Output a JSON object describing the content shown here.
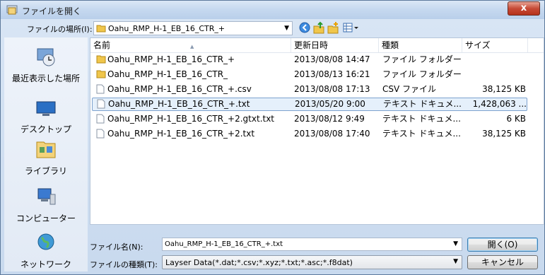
{
  "window": {
    "title": "ファイルを開く",
    "close_label": "x"
  },
  "lookin": {
    "label": "ファイルの場所(I):",
    "value": "Oahu_RMP_H-1_EB_16_CTR_+"
  },
  "toolbar": {
    "icons": [
      "back-icon",
      "up-folder-icon",
      "new-folder-icon",
      "view-menu-icon"
    ]
  },
  "sidebar": {
    "items": [
      {
        "label": "最近表示した場所",
        "icon": "recent-places-icon"
      },
      {
        "label": "デスクトップ",
        "icon": "desktop-icon"
      },
      {
        "label": "ライブラリ",
        "icon": "libraries-icon"
      },
      {
        "label": "コンピューター",
        "icon": "computer-icon"
      },
      {
        "label": "ネットワーク",
        "icon": "network-icon"
      }
    ]
  },
  "columns": {
    "name": "名前",
    "date": "更新日時",
    "type": "種類",
    "size": "サイズ"
  },
  "files": [
    {
      "name": "Oahu_RMP_H-1_EB_16_CTR_+",
      "date": "2013/08/08 14:47",
      "type": "ファイル フォルダー",
      "size": "",
      "icon": "folder-icon",
      "selected": false
    },
    {
      "name": "Oahu_RMP_H-1_EB_16_CTR_",
      "date": "2013/08/13 16:21",
      "type": "ファイル フォルダー",
      "size": "",
      "icon": "folder-icon",
      "selected": false
    },
    {
      "name": "Oahu_RMP_H-1_EB_16_CTR_+.csv",
      "date": "2013/08/08 17:13",
      "type": "CSV ファイル",
      "size": "38,125 KB",
      "icon": "file-icon",
      "selected": false
    },
    {
      "name": "Oahu_RMP_H-1_EB_16_CTR_+.txt",
      "date": "2013/05/20 9:00",
      "type": "テキスト ドキュメ...",
      "size": "1,428,063 ...",
      "icon": "file-icon",
      "selected": true
    },
    {
      "name": "Oahu_RMP_H-1_EB_16_CTR_+2.gtxt.txt",
      "date": "2013/08/12 9:49",
      "type": "テキスト ドキュメ...",
      "size": "6 KB",
      "icon": "file-icon",
      "selected": false
    },
    {
      "name": "Oahu_RMP_H-1_EB_16_CTR_+2.txt",
      "date": "2013/08/08 17:40",
      "type": "テキスト ドキュメ...",
      "size": "38,125 KB",
      "icon": "file-icon",
      "selected": false
    }
  ],
  "filename": {
    "label": "ファイル名(N):",
    "value": "Oahu_RMP_H-1_EB_16_CTR_+.txt"
  },
  "filetype": {
    "label": "ファイルの種類(T):",
    "value": "Layser Data(*.dat;*.csv;*.xyz;*.txt;*.asc;*.f8dat)"
  },
  "buttons": {
    "open": "開く(O)",
    "cancel": "キャンセル"
  }
}
